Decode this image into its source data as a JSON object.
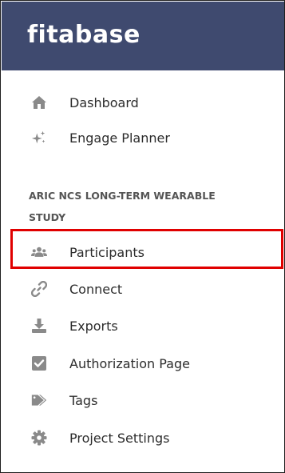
{
  "app": {
    "logo_text": "fitabase",
    "header_color": "#3f4a6f"
  },
  "nav_top": [
    {
      "label": "Dashboard",
      "icon": "home-icon"
    },
    {
      "label": "Engage Planner",
      "icon": "sparkle-icon"
    }
  ],
  "study": {
    "heading": "ARIC NCS LONG-TERM WEARABLE STUDY"
  },
  "nav_study": [
    {
      "label": "Participants",
      "icon": "users-icon",
      "highlighted": true
    },
    {
      "label": "Connect",
      "icon": "link-icon"
    },
    {
      "label": "Exports",
      "icon": "download-icon"
    },
    {
      "label": "Authorization Page",
      "icon": "check-square-icon"
    },
    {
      "label": "Tags",
      "icon": "tags-icon"
    },
    {
      "label": "Project Settings",
      "icon": "gear-icon"
    }
  ],
  "colors": {
    "icon_gray": "#8a8a8a",
    "highlight_red": "#e00000"
  }
}
